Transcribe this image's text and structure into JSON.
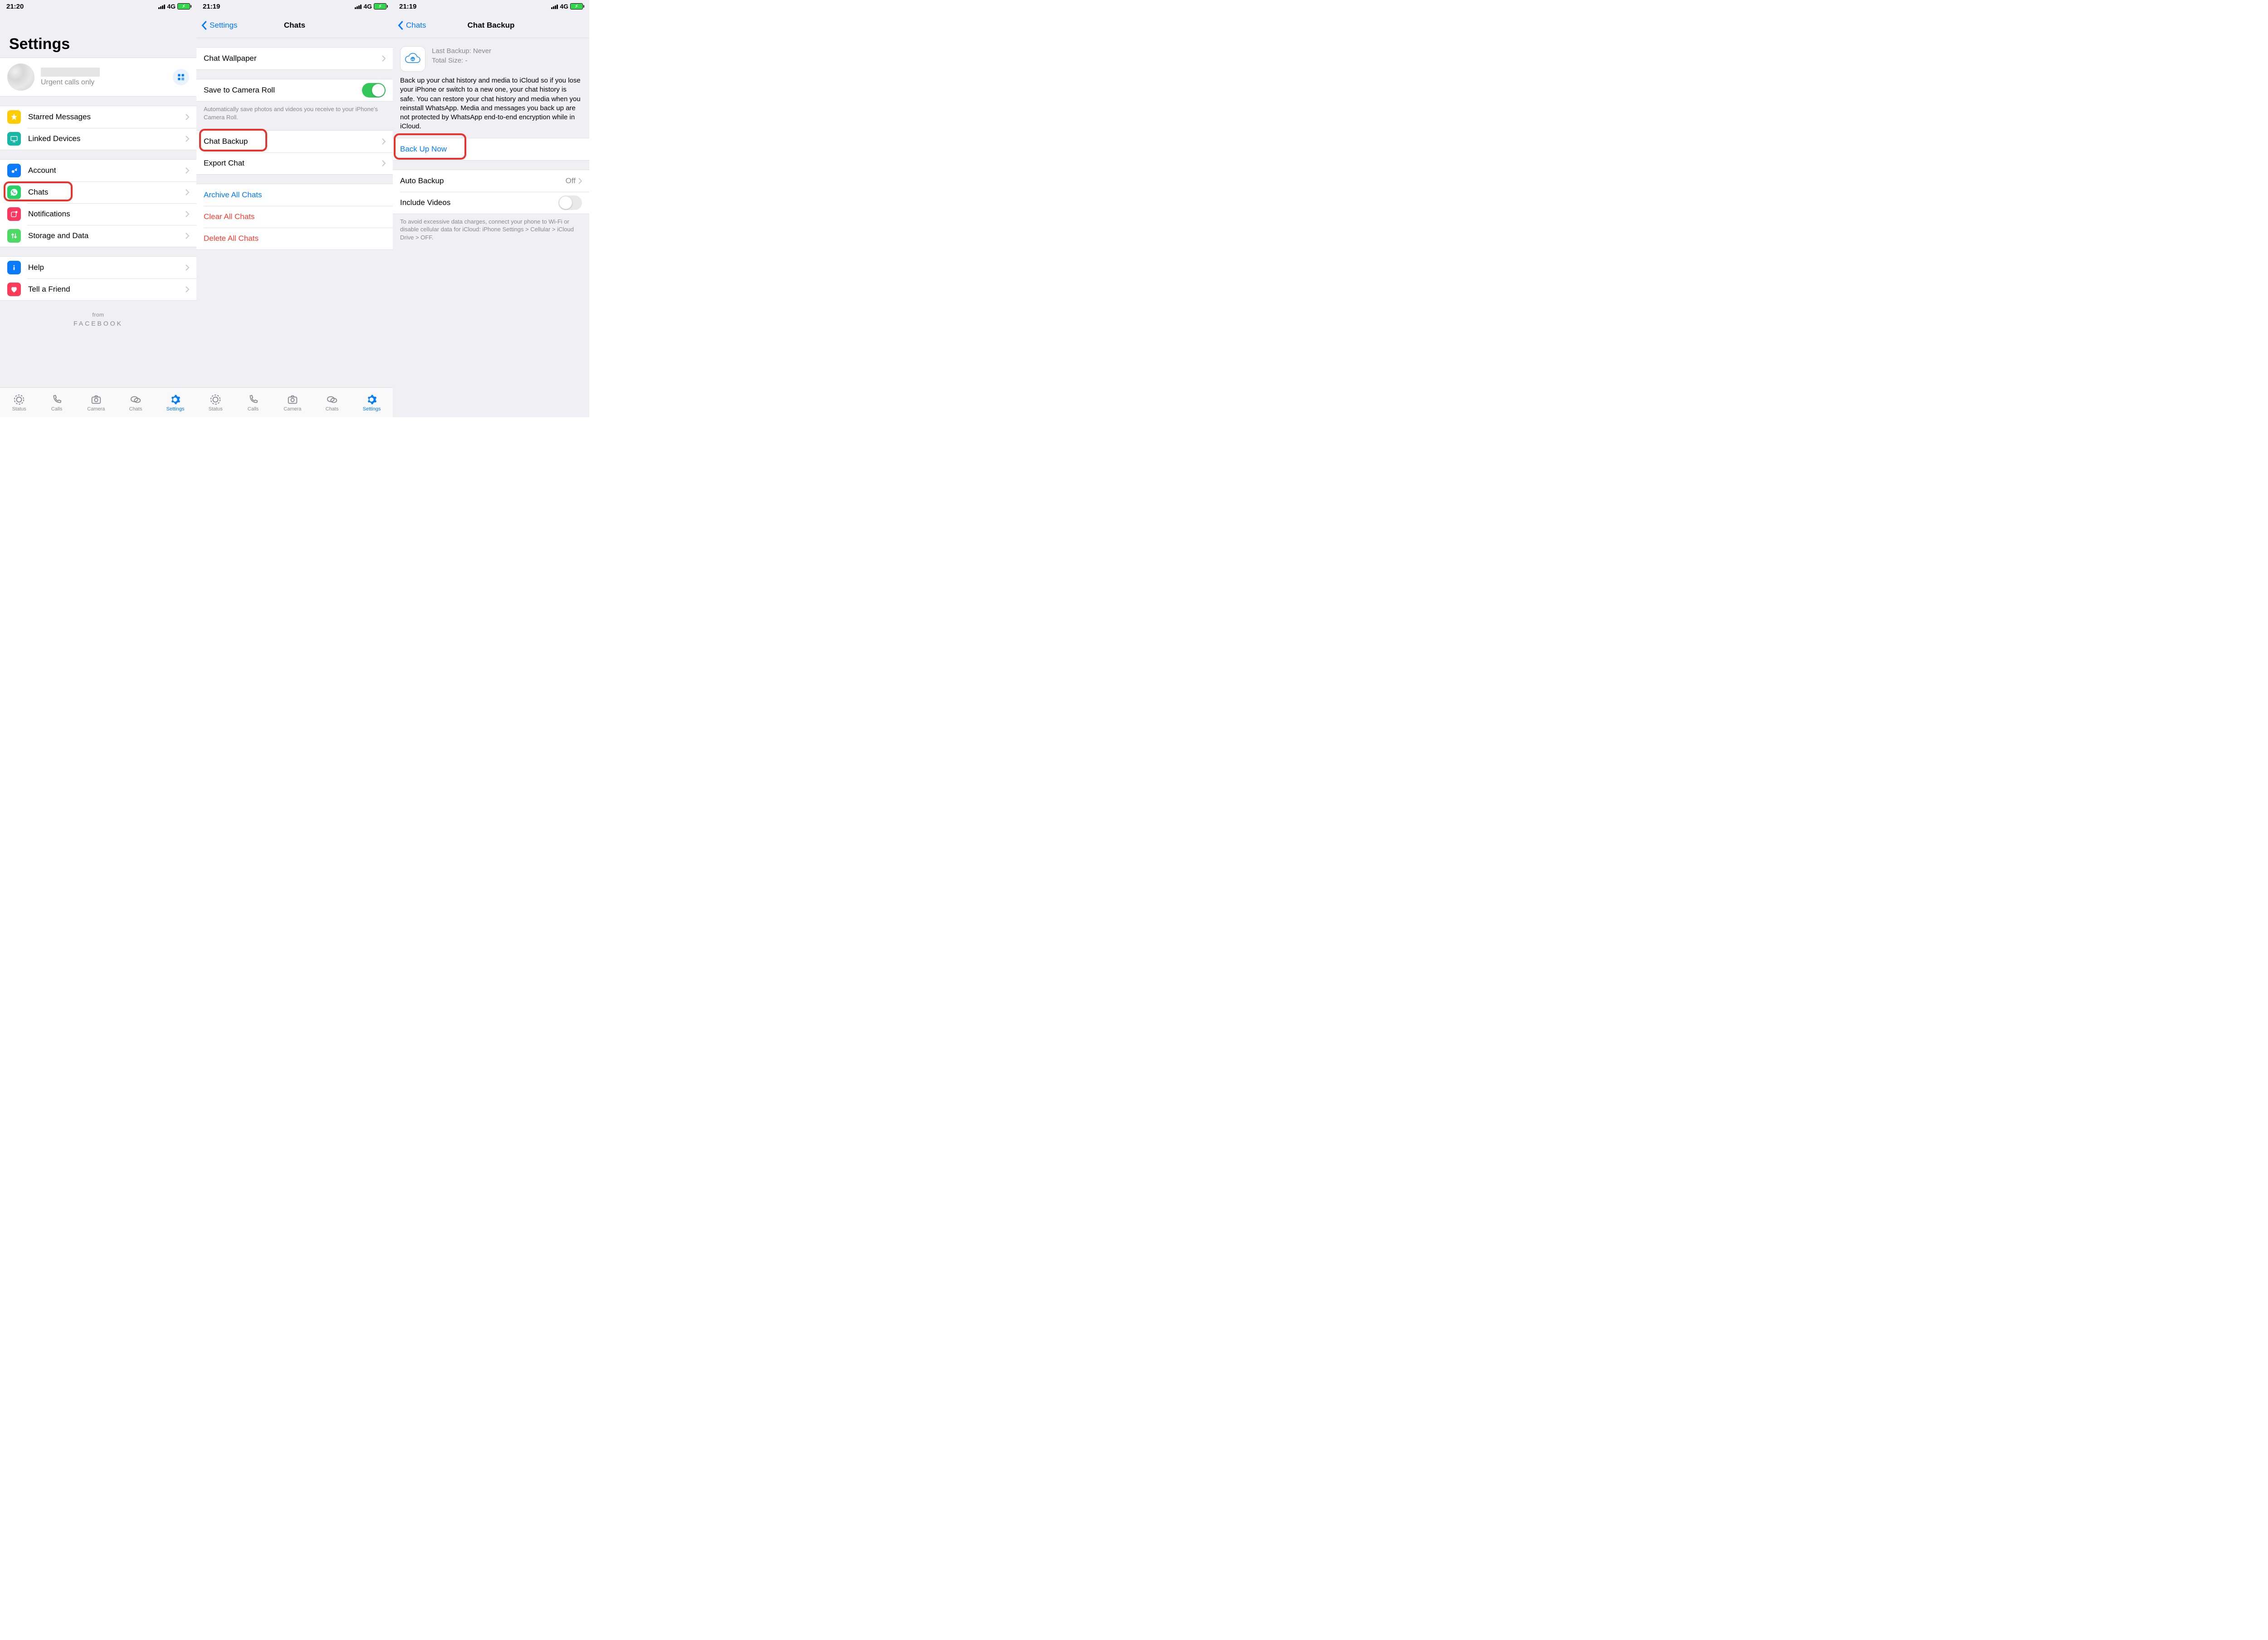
{
  "screen1": {
    "status": {
      "time": "21:20",
      "network": "4G"
    },
    "title": "Settings",
    "profile": {
      "status": "Urgent calls only"
    },
    "group1": {
      "starred": "Starred Messages",
      "linked": "Linked Devices"
    },
    "group2": {
      "account": "Account",
      "chats": "Chats",
      "notifications": "Notifications",
      "storage": "Storage and Data"
    },
    "group3": {
      "help": "Help",
      "tell": "Tell a Friend"
    },
    "footer": {
      "from": "from",
      "brand": "FACEBOOK"
    },
    "tabs": {
      "status": "Status",
      "calls": "Calls",
      "camera": "Camera",
      "chats": "Chats",
      "settings": "Settings"
    }
  },
  "screen2": {
    "status": {
      "time": "21:19",
      "network": "4G"
    },
    "nav": {
      "back": "Settings",
      "title": "Chats"
    },
    "wallpaper": "Chat Wallpaper",
    "save_roll": "Save to Camera Roll",
    "save_roll_footer": "Automatically save photos and videos you receive to your iPhone's Camera Roll.",
    "chat_backup": "Chat Backup",
    "export_chat": "Export Chat",
    "archive": "Archive All Chats",
    "clear": "Clear All Chats",
    "delete": "Delete All Chats",
    "tabs": {
      "status": "Status",
      "calls": "Calls",
      "camera": "Camera",
      "chats": "Chats",
      "settings": "Settings"
    }
  },
  "screen3": {
    "status": {
      "time": "21:19",
      "network": "4G"
    },
    "nav": {
      "back": "Chats",
      "title": "Chat Backup"
    },
    "meta": {
      "last_label": "Last Backup:",
      "last_value": "Never",
      "size_label": "Total Size:",
      "size_value": "-"
    },
    "desc": "Back up your chat history and media to iCloud so if you lose your iPhone or switch to a new one, your chat history is safe. You can restore your chat history and media when you reinstall WhatsApp. Media and messages you back up are not protected by WhatsApp end-to-end encryption while in iCloud.",
    "backup_now": "Back Up Now",
    "auto_backup": {
      "label": "Auto Backup",
      "value": "Off"
    },
    "include_videos": "Include Videos",
    "footer": "To avoid excessive data charges, connect your phone to Wi-Fi or disable cellular data for iCloud: iPhone Settings > Cellular > iCloud Drive > OFF."
  }
}
